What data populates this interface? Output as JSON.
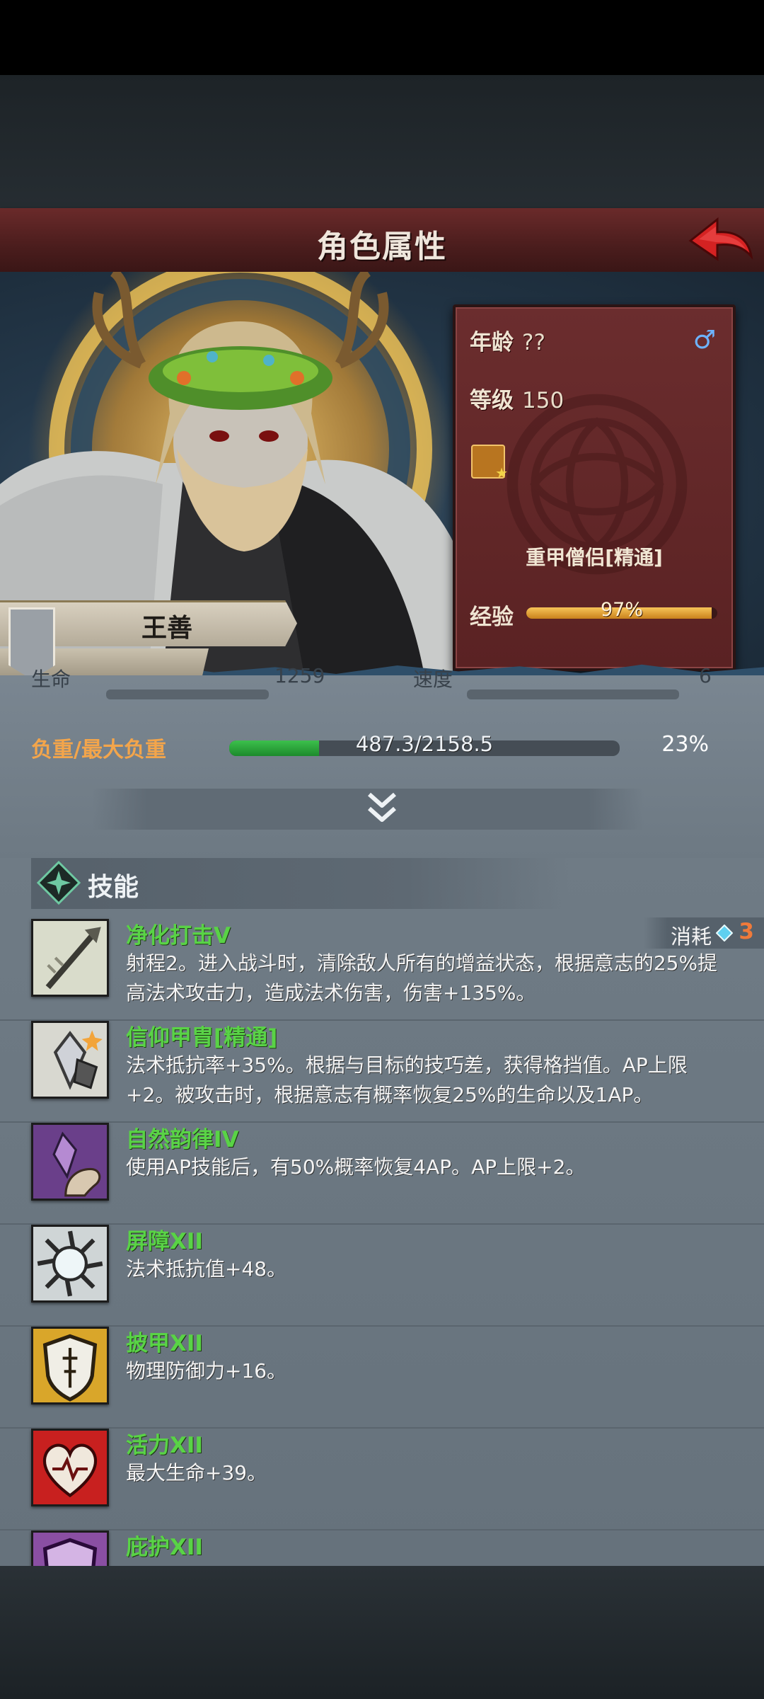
{
  "header": {
    "title": "角色属性"
  },
  "character": {
    "name": "王善",
    "age_label": "年龄",
    "age_value": "??",
    "level_label": "等级",
    "level_value": "150",
    "class_name": "重甲僧侣[精通]",
    "exp_label": "经验",
    "exp_text": "97%",
    "exp_fraction": 0.97,
    "gender_symbol": "♂"
  },
  "stats": {
    "cut_row": {
      "left_label": "生命",
      "left_value": "1259",
      "right_label": "速度",
      "right_value": "6"
    },
    "weight_label": "负重/最大负重",
    "weight_text": "487.3/2158.5",
    "weight_pct": "23%",
    "weight_fraction": 0.23
  },
  "skills_section": {
    "title": "技能"
  },
  "skills": [
    {
      "name": "净化打击V",
      "desc": "射程2。进入战斗时，清除敌人所有的增益状态，根据意志的25%提高法术攻击力，造成法术伤害，伤害+135%。",
      "cost_label": "消耗",
      "cost_value": "3",
      "icon": "spear-strike-icon",
      "icon_bg": "#d9dccb"
    },
    {
      "name": "信仰甲胄[精通]",
      "desc": "法术抵抗率+35%。根据与目标的技巧差，获得格挡值。AP上限+2。被攻击时，根据意志有概率恢复25%的生命以及1AP。",
      "icon": "faith-armor-icon",
      "icon_bg": "#d8d8d0"
    },
    {
      "name": "自然韵律IV",
      "desc": "使用AP技能后，有50%概率恢复4AP。AP上限+2。",
      "icon": "crystal-hand-icon",
      "icon_bg": "#6a3f8a"
    },
    {
      "name": "屏障XII",
      "desc": "法术抵抗值+48。",
      "icon": "barrier-burst-icon",
      "icon_bg": "#cfd5d6"
    },
    {
      "name": "披甲XII",
      "desc": "物理防御力+16。",
      "icon": "shield-icon",
      "icon_bg": "#d9a62a"
    },
    {
      "name": "活力XII",
      "desc": "最大生命+39。",
      "icon": "heart-icon",
      "icon_bg": "#c8201f"
    },
    {
      "name": "庇护XII",
      "desc": "",
      "icon": "sanctuary-shield-icon",
      "icon_bg": "#8a4fa3"
    }
  ],
  "colors": {
    "skill_name": "#59d346",
    "header": "#5a2223",
    "cost": "#f07a3a",
    "weight_label": "#f3a54b"
  }
}
